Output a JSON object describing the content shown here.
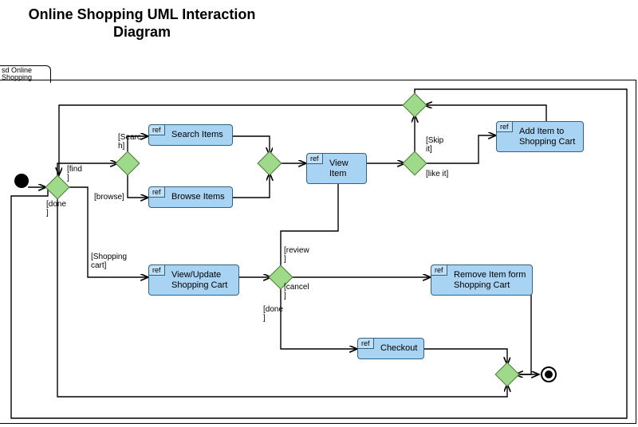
{
  "title_line1": "Online Shopping UML Interaction",
  "title_line2": "Diagram",
  "frame_name": "sd Online Shopping",
  "ref_tag": "ref",
  "refs": {
    "search": "Search Items",
    "browse": "Browse Items",
    "view_item": "View Item",
    "add_cart": "Add Item to Shopping Cart",
    "view_update_cart": "View/Update Shopping Cart",
    "remove_cart": "Remove Item form Shopping Cart",
    "checkout": "Checkout"
  },
  "guards": {
    "find": "[find\n]",
    "done_top": "[done\n]",
    "search": "[Searc\nh]",
    "browse": "[browse]",
    "skip_it": "[Skip\nit]",
    "like_it": "[like it]",
    "shopping_cart": "[Shopping\ncart]",
    "review": "[review\n]",
    "cancel": "[cancel\n]",
    "done_bottom": "[done\n]"
  },
  "nodes": {
    "initial": "initial-node",
    "final": "final-node",
    "d1": "decision-after-initial",
    "d2": "decision-find-branch",
    "d3": "merge-search-browse",
    "d4": "decision-after-view-item",
    "d5": "merge-top-loop",
    "d6": "decision-cart-actions",
    "d7": "merge-before-final"
  }
}
